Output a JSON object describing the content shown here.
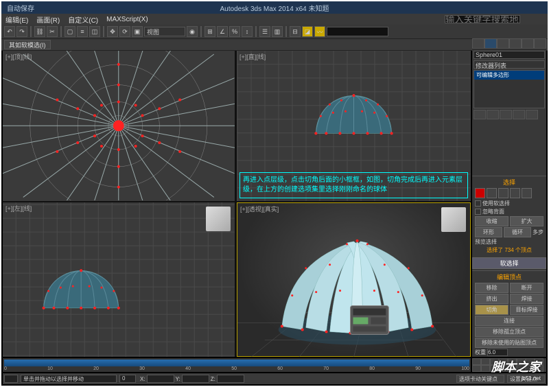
{
  "title": "Autodesk 3ds Max 2014 x64    未知题",
  "titleLeft": "自动保存",
  "menu": {
    "items": [
      "编辑(E)",
      "画面(R)",
      "自定义(C)",
      "MAXScript(X)"
    ]
  },
  "search": {
    "placeholder": "输入关键字搜索地"
  },
  "ribbon": {
    "label": "其如软模选(I)"
  },
  "toolbar": {
    "viewSelector": "视图"
  },
  "viewports": {
    "tl": {
      "label": "[+][顶][线]"
    },
    "tr": {
      "label": "[+][直][线]"
    },
    "bl": {
      "label": "[+][左][线]"
    },
    "br": {
      "label": "[+][透视][真实]"
    }
  },
  "annotation": {
    "tr": "再进入点层级，点击切角后面的小框框，如图，切角完成后再进入元素层级，在上方的创建选项集里选择刚刚命名的球体"
  },
  "commandPanel": {
    "objName": "Sphere01",
    "modListLabel": "修改器列表",
    "stack": {
      "active": "可编辑多边形"
    },
    "selection": {
      "title": "选择",
      "useSoftLabel": "使用软选择",
      "ignoreBackLabel": "忽略背面",
      "shrinkLabel": "收缩",
      "growLabel": "扩大",
      "ringLabel": "环形",
      "loopLabel": "循环",
      "loopStep": "多步",
      "prevLabel": "预览选择",
      "selectedCount": "选择了 734 个顶点"
    },
    "softSel": {
      "title": "软选择"
    },
    "editVerts": {
      "title": "编辑顶点",
      "removeLabel": "移除",
      "breakLabel": "断开",
      "extrudeLabel": "挤出",
      "weldLabel": "焊接",
      "chamferLabel": "切角",
      "targetWeldLabel": "目标焊接",
      "connectLabel": "连接",
      "removeIsoLabel": "移除孤立顶点",
      "removeUnusedLabel": "移除未使用的贴图顶点",
      "weightLabel": "权重",
      "weightValue": "6.0"
    }
  },
  "timeline": {
    "ticks": [
      "0",
      "10",
      "20",
      "30",
      "40",
      "50",
      "60",
      "70",
      "80",
      "90",
      "100"
    ]
  },
  "status": {
    "frame": "0",
    "prompt": "单击并拖动以选择并移动",
    "autoKey": "选项卡动关键点",
    "setKey": "设置关键点"
  },
  "watermark": {
    "main": "脚本之家",
    "sub": "jb51.net"
  }
}
